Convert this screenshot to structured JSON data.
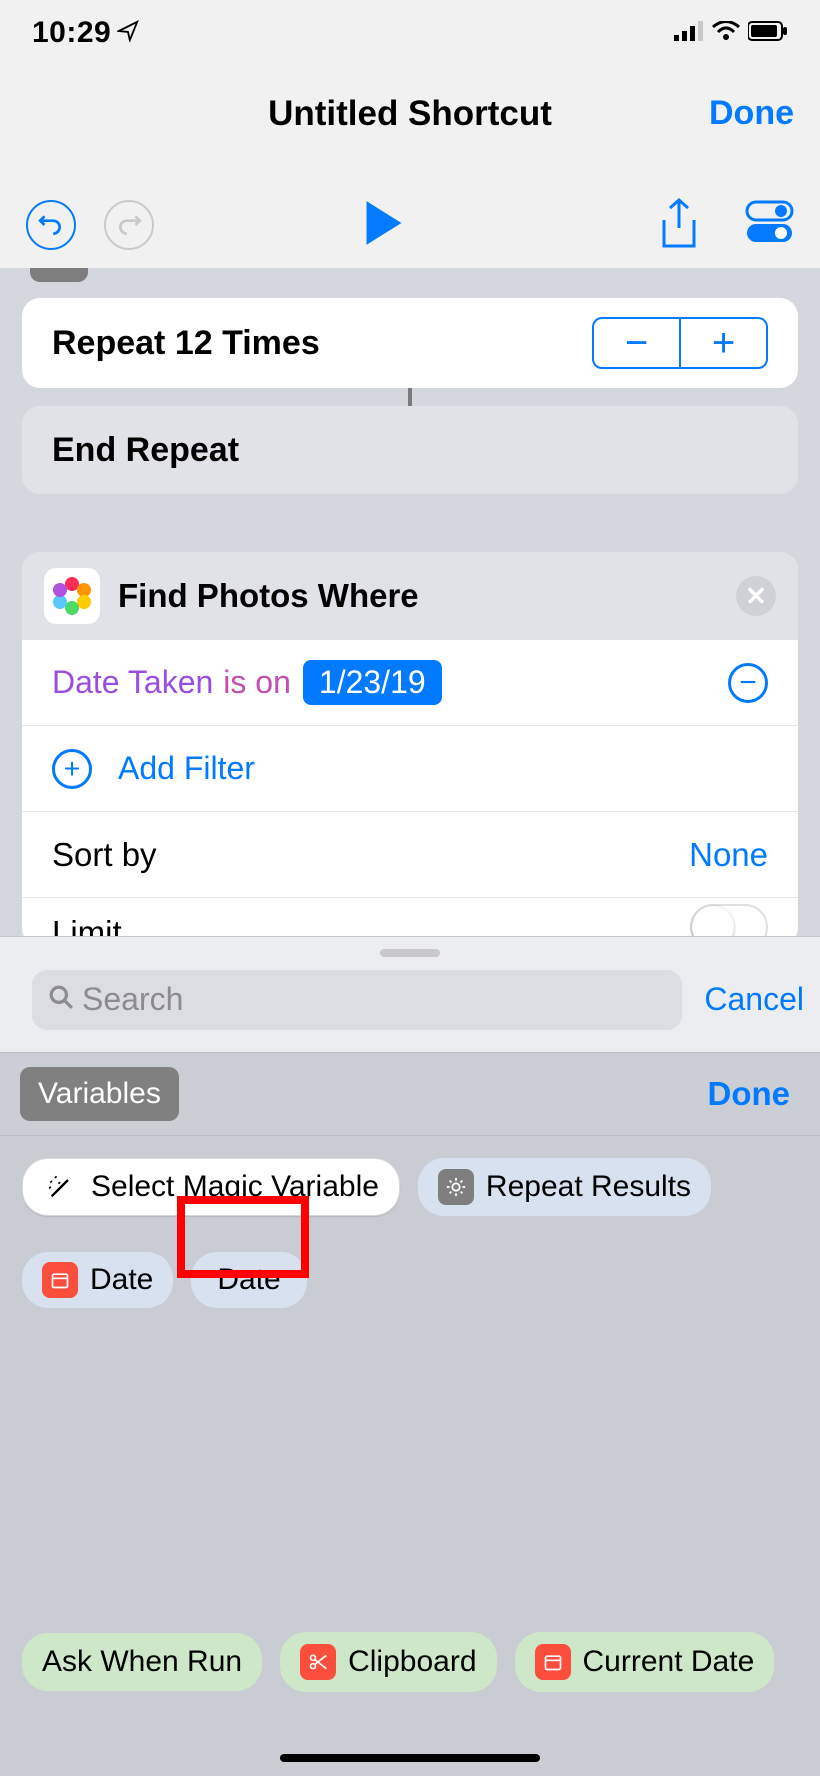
{
  "status": {
    "time": "10:29"
  },
  "header": {
    "title": "Untitled Shortcut",
    "done": "Done"
  },
  "toolbar": {
    "undo": "undo",
    "redo": "redo"
  },
  "repeat": {
    "label": "Repeat 12 Times"
  },
  "end_repeat": {
    "label": "End Repeat"
  },
  "find_photos": {
    "title": "Find Photos Where",
    "date_taken_label": "Date Taken",
    "is_on_label": "is on",
    "date_value": "1/23/19",
    "add_filter": "Add Filter",
    "sort_by_label": "Sort by",
    "sort_by_value": "None",
    "limit_label": "Limit"
  },
  "search": {
    "placeholder": "Search",
    "cancel": "Cancel"
  },
  "variables": {
    "header": "Variables",
    "done": "Done",
    "select_magic": "Select Magic Variable",
    "repeat_results": "Repeat Results",
    "date1": "Date",
    "date2": "Date"
  },
  "suggestions": {
    "ask_when_run": "Ask When Run",
    "clipboard": "Clipboard",
    "current_date": "Current Date"
  }
}
